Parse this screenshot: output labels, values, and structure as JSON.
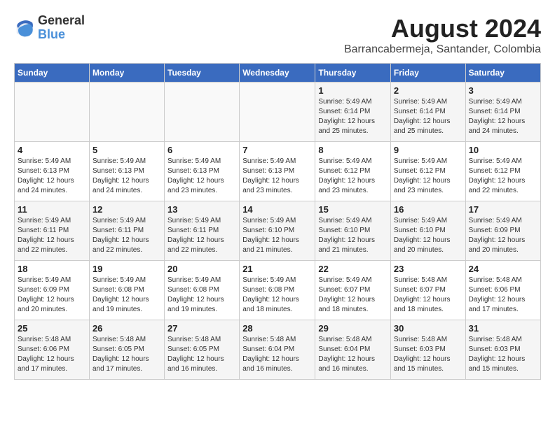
{
  "header": {
    "logo": {
      "general": "General",
      "blue": "Blue"
    },
    "month": "August 2024",
    "location": "Barrancabermeja, Santander, Colombia"
  },
  "weekdays": [
    "Sunday",
    "Monday",
    "Tuesday",
    "Wednesday",
    "Thursday",
    "Friday",
    "Saturday"
  ],
  "weeks": [
    [
      {
        "day": "",
        "info": ""
      },
      {
        "day": "",
        "info": ""
      },
      {
        "day": "",
        "info": ""
      },
      {
        "day": "",
        "info": ""
      },
      {
        "day": "1",
        "info": "Sunrise: 5:49 AM\nSunset: 6:14 PM\nDaylight: 12 hours\nand 25 minutes."
      },
      {
        "day": "2",
        "info": "Sunrise: 5:49 AM\nSunset: 6:14 PM\nDaylight: 12 hours\nand 25 minutes."
      },
      {
        "day": "3",
        "info": "Sunrise: 5:49 AM\nSunset: 6:14 PM\nDaylight: 12 hours\nand 24 minutes."
      }
    ],
    [
      {
        "day": "4",
        "info": "Sunrise: 5:49 AM\nSunset: 6:13 PM\nDaylight: 12 hours\nand 24 minutes."
      },
      {
        "day": "5",
        "info": "Sunrise: 5:49 AM\nSunset: 6:13 PM\nDaylight: 12 hours\nand 24 minutes."
      },
      {
        "day": "6",
        "info": "Sunrise: 5:49 AM\nSunset: 6:13 PM\nDaylight: 12 hours\nand 23 minutes."
      },
      {
        "day": "7",
        "info": "Sunrise: 5:49 AM\nSunset: 6:13 PM\nDaylight: 12 hours\nand 23 minutes."
      },
      {
        "day": "8",
        "info": "Sunrise: 5:49 AM\nSunset: 6:12 PM\nDaylight: 12 hours\nand 23 minutes."
      },
      {
        "day": "9",
        "info": "Sunrise: 5:49 AM\nSunset: 6:12 PM\nDaylight: 12 hours\nand 23 minutes."
      },
      {
        "day": "10",
        "info": "Sunrise: 5:49 AM\nSunset: 6:12 PM\nDaylight: 12 hours\nand 22 minutes."
      }
    ],
    [
      {
        "day": "11",
        "info": "Sunrise: 5:49 AM\nSunset: 6:11 PM\nDaylight: 12 hours\nand 22 minutes."
      },
      {
        "day": "12",
        "info": "Sunrise: 5:49 AM\nSunset: 6:11 PM\nDaylight: 12 hours\nand 22 minutes."
      },
      {
        "day": "13",
        "info": "Sunrise: 5:49 AM\nSunset: 6:11 PM\nDaylight: 12 hours\nand 22 minutes."
      },
      {
        "day": "14",
        "info": "Sunrise: 5:49 AM\nSunset: 6:10 PM\nDaylight: 12 hours\nand 21 minutes."
      },
      {
        "day": "15",
        "info": "Sunrise: 5:49 AM\nSunset: 6:10 PM\nDaylight: 12 hours\nand 21 minutes."
      },
      {
        "day": "16",
        "info": "Sunrise: 5:49 AM\nSunset: 6:10 PM\nDaylight: 12 hours\nand 20 minutes."
      },
      {
        "day": "17",
        "info": "Sunrise: 5:49 AM\nSunset: 6:09 PM\nDaylight: 12 hours\nand 20 minutes."
      }
    ],
    [
      {
        "day": "18",
        "info": "Sunrise: 5:49 AM\nSunset: 6:09 PM\nDaylight: 12 hours\nand 20 minutes."
      },
      {
        "day": "19",
        "info": "Sunrise: 5:49 AM\nSunset: 6:08 PM\nDaylight: 12 hours\nand 19 minutes."
      },
      {
        "day": "20",
        "info": "Sunrise: 5:49 AM\nSunset: 6:08 PM\nDaylight: 12 hours\nand 19 minutes."
      },
      {
        "day": "21",
        "info": "Sunrise: 5:49 AM\nSunset: 6:08 PM\nDaylight: 12 hours\nand 18 minutes."
      },
      {
        "day": "22",
        "info": "Sunrise: 5:49 AM\nSunset: 6:07 PM\nDaylight: 12 hours\nand 18 minutes."
      },
      {
        "day": "23",
        "info": "Sunrise: 5:48 AM\nSunset: 6:07 PM\nDaylight: 12 hours\nand 18 minutes."
      },
      {
        "day": "24",
        "info": "Sunrise: 5:48 AM\nSunset: 6:06 PM\nDaylight: 12 hours\nand 17 minutes."
      }
    ],
    [
      {
        "day": "25",
        "info": "Sunrise: 5:48 AM\nSunset: 6:06 PM\nDaylight: 12 hours\nand 17 minutes."
      },
      {
        "day": "26",
        "info": "Sunrise: 5:48 AM\nSunset: 6:05 PM\nDaylight: 12 hours\nand 17 minutes."
      },
      {
        "day": "27",
        "info": "Sunrise: 5:48 AM\nSunset: 6:05 PM\nDaylight: 12 hours\nand 16 minutes."
      },
      {
        "day": "28",
        "info": "Sunrise: 5:48 AM\nSunset: 6:04 PM\nDaylight: 12 hours\nand 16 minutes."
      },
      {
        "day": "29",
        "info": "Sunrise: 5:48 AM\nSunset: 6:04 PM\nDaylight: 12 hours\nand 16 minutes."
      },
      {
        "day": "30",
        "info": "Sunrise: 5:48 AM\nSunset: 6:03 PM\nDaylight: 12 hours\nand 15 minutes."
      },
      {
        "day": "31",
        "info": "Sunrise: 5:48 AM\nSunset: 6:03 PM\nDaylight: 12 hours\nand 15 minutes."
      }
    ]
  ]
}
